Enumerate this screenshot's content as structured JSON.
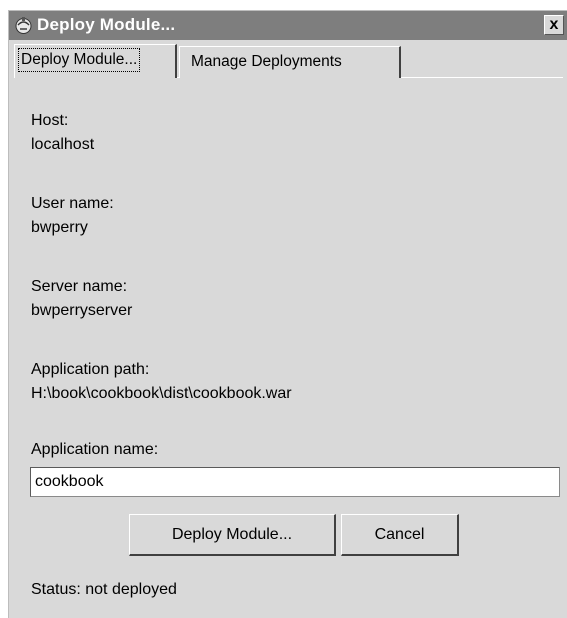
{
  "window": {
    "title": "Deploy Module...",
    "close_label": "x"
  },
  "tabs": [
    {
      "label": "Deploy Module...",
      "active": true
    },
    {
      "label": "Manage Deployments",
      "active": false
    }
  ],
  "fields": {
    "host": {
      "label": "Host:",
      "value": "localhost"
    },
    "user": {
      "label": "User name:",
      "value": "bwperry"
    },
    "server": {
      "label": "Server name:",
      "value": "bwperryserver"
    },
    "path": {
      "label": "Application path:",
      "value": "H:\\book\\cookbook\\dist\\cookbook.war"
    },
    "app_name": {
      "label": "Application name:",
      "value": "cookbook"
    }
  },
  "buttons": {
    "deploy": "Deploy Module...",
    "cancel": "Cancel"
  },
  "status": {
    "text": "Status:  not deployed"
  },
  "icons": {
    "title_icon": "app-window-icon",
    "close_icon": "close-icon"
  }
}
